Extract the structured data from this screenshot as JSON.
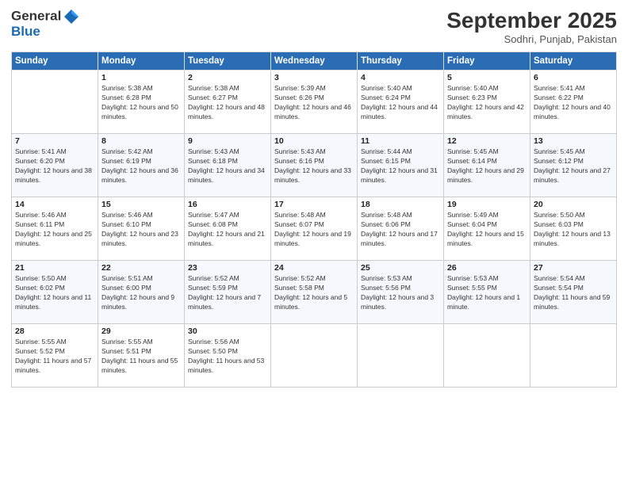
{
  "header": {
    "logo_text_general": "General",
    "logo_text_blue": "Blue",
    "month_title": "September 2025",
    "subtitle": "Sodhri, Punjab, Pakistan"
  },
  "days_of_week": [
    "Sunday",
    "Monday",
    "Tuesday",
    "Wednesday",
    "Thursday",
    "Friday",
    "Saturday"
  ],
  "weeks": [
    [
      {
        "date": "",
        "sunrise": "",
        "sunset": "",
        "daylight": ""
      },
      {
        "date": "1",
        "sunrise": "Sunrise: 5:38 AM",
        "sunset": "Sunset: 6:28 PM",
        "daylight": "Daylight: 12 hours and 50 minutes."
      },
      {
        "date": "2",
        "sunrise": "Sunrise: 5:38 AM",
        "sunset": "Sunset: 6:27 PM",
        "daylight": "Daylight: 12 hours and 48 minutes."
      },
      {
        "date": "3",
        "sunrise": "Sunrise: 5:39 AM",
        "sunset": "Sunset: 6:26 PM",
        "daylight": "Daylight: 12 hours and 46 minutes."
      },
      {
        "date": "4",
        "sunrise": "Sunrise: 5:40 AM",
        "sunset": "Sunset: 6:24 PM",
        "daylight": "Daylight: 12 hours and 44 minutes."
      },
      {
        "date": "5",
        "sunrise": "Sunrise: 5:40 AM",
        "sunset": "Sunset: 6:23 PM",
        "daylight": "Daylight: 12 hours and 42 minutes."
      },
      {
        "date": "6",
        "sunrise": "Sunrise: 5:41 AM",
        "sunset": "Sunset: 6:22 PM",
        "daylight": "Daylight: 12 hours and 40 minutes."
      }
    ],
    [
      {
        "date": "7",
        "sunrise": "Sunrise: 5:41 AM",
        "sunset": "Sunset: 6:20 PM",
        "daylight": "Daylight: 12 hours and 38 minutes."
      },
      {
        "date": "8",
        "sunrise": "Sunrise: 5:42 AM",
        "sunset": "Sunset: 6:19 PM",
        "daylight": "Daylight: 12 hours and 36 minutes."
      },
      {
        "date": "9",
        "sunrise": "Sunrise: 5:43 AM",
        "sunset": "Sunset: 6:18 PM",
        "daylight": "Daylight: 12 hours and 34 minutes."
      },
      {
        "date": "10",
        "sunrise": "Sunrise: 5:43 AM",
        "sunset": "Sunset: 6:16 PM",
        "daylight": "Daylight: 12 hours and 33 minutes."
      },
      {
        "date": "11",
        "sunrise": "Sunrise: 5:44 AM",
        "sunset": "Sunset: 6:15 PM",
        "daylight": "Daylight: 12 hours and 31 minutes."
      },
      {
        "date": "12",
        "sunrise": "Sunrise: 5:45 AM",
        "sunset": "Sunset: 6:14 PM",
        "daylight": "Daylight: 12 hours and 29 minutes."
      },
      {
        "date": "13",
        "sunrise": "Sunrise: 5:45 AM",
        "sunset": "Sunset: 6:12 PM",
        "daylight": "Daylight: 12 hours and 27 minutes."
      }
    ],
    [
      {
        "date": "14",
        "sunrise": "Sunrise: 5:46 AM",
        "sunset": "Sunset: 6:11 PM",
        "daylight": "Daylight: 12 hours and 25 minutes."
      },
      {
        "date": "15",
        "sunrise": "Sunrise: 5:46 AM",
        "sunset": "Sunset: 6:10 PM",
        "daylight": "Daylight: 12 hours and 23 minutes."
      },
      {
        "date": "16",
        "sunrise": "Sunrise: 5:47 AM",
        "sunset": "Sunset: 6:08 PM",
        "daylight": "Daylight: 12 hours and 21 minutes."
      },
      {
        "date": "17",
        "sunrise": "Sunrise: 5:48 AM",
        "sunset": "Sunset: 6:07 PM",
        "daylight": "Daylight: 12 hours and 19 minutes."
      },
      {
        "date": "18",
        "sunrise": "Sunrise: 5:48 AM",
        "sunset": "Sunset: 6:06 PM",
        "daylight": "Daylight: 12 hours and 17 minutes."
      },
      {
        "date": "19",
        "sunrise": "Sunrise: 5:49 AM",
        "sunset": "Sunset: 6:04 PM",
        "daylight": "Daylight: 12 hours and 15 minutes."
      },
      {
        "date": "20",
        "sunrise": "Sunrise: 5:50 AM",
        "sunset": "Sunset: 6:03 PM",
        "daylight": "Daylight: 12 hours and 13 minutes."
      }
    ],
    [
      {
        "date": "21",
        "sunrise": "Sunrise: 5:50 AM",
        "sunset": "Sunset: 6:02 PM",
        "daylight": "Daylight: 12 hours and 11 minutes."
      },
      {
        "date": "22",
        "sunrise": "Sunrise: 5:51 AM",
        "sunset": "Sunset: 6:00 PM",
        "daylight": "Daylight: 12 hours and 9 minutes."
      },
      {
        "date": "23",
        "sunrise": "Sunrise: 5:52 AM",
        "sunset": "Sunset: 5:59 PM",
        "daylight": "Daylight: 12 hours and 7 minutes."
      },
      {
        "date": "24",
        "sunrise": "Sunrise: 5:52 AM",
        "sunset": "Sunset: 5:58 PM",
        "daylight": "Daylight: 12 hours and 5 minutes."
      },
      {
        "date": "25",
        "sunrise": "Sunrise: 5:53 AM",
        "sunset": "Sunset: 5:56 PM",
        "daylight": "Daylight: 12 hours and 3 minutes."
      },
      {
        "date": "26",
        "sunrise": "Sunrise: 5:53 AM",
        "sunset": "Sunset: 5:55 PM",
        "daylight": "Daylight: 12 hours and 1 minute."
      },
      {
        "date": "27",
        "sunrise": "Sunrise: 5:54 AM",
        "sunset": "Sunset: 5:54 PM",
        "daylight": "Daylight: 11 hours and 59 minutes."
      }
    ],
    [
      {
        "date": "28",
        "sunrise": "Sunrise: 5:55 AM",
        "sunset": "Sunset: 5:52 PM",
        "daylight": "Daylight: 11 hours and 57 minutes."
      },
      {
        "date": "29",
        "sunrise": "Sunrise: 5:55 AM",
        "sunset": "Sunset: 5:51 PM",
        "daylight": "Daylight: 11 hours and 55 minutes."
      },
      {
        "date": "30",
        "sunrise": "Sunrise: 5:56 AM",
        "sunset": "Sunset: 5:50 PM",
        "daylight": "Daylight: 11 hours and 53 minutes."
      },
      {
        "date": "",
        "sunrise": "",
        "sunset": "",
        "daylight": ""
      },
      {
        "date": "",
        "sunrise": "",
        "sunset": "",
        "daylight": ""
      },
      {
        "date": "",
        "sunrise": "",
        "sunset": "",
        "daylight": ""
      },
      {
        "date": "",
        "sunrise": "",
        "sunset": "",
        "daylight": ""
      }
    ]
  ]
}
